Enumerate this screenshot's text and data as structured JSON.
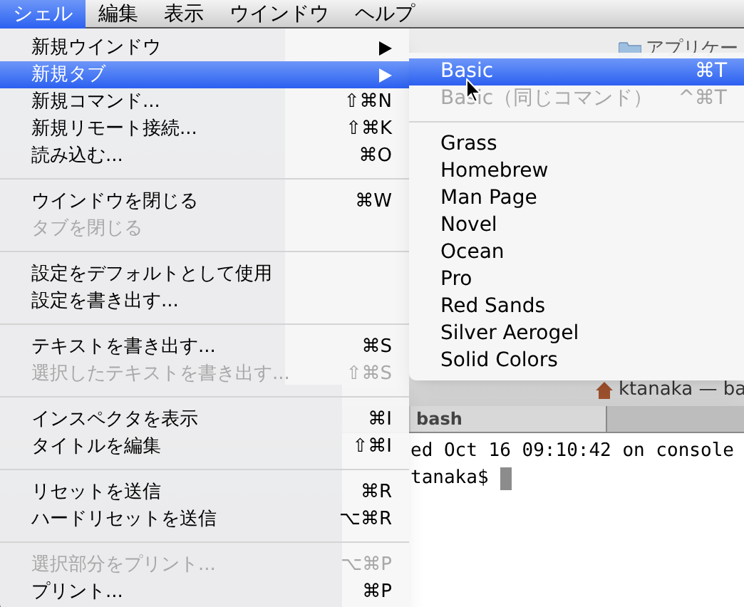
{
  "menu_bar": [
    {
      "label": "シェル",
      "selected": true
    },
    {
      "label": "編集",
      "selected": false
    },
    {
      "label": "表示",
      "selected": false
    },
    {
      "label": "ウインドウ",
      "selected": false
    },
    {
      "label": "ヘルプ",
      "selected": false
    }
  ],
  "shell_menu": [
    {
      "kind": "item",
      "label": "新規ウインドウ",
      "submenu": true,
      "selected": false,
      "disabled": false
    },
    {
      "kind": "item",
      "label": "新規タブ",
      "submenu": true,
      "selected": true,
      "disabled": false
    },
    {
      "kind": "item",
      "label": "新規コマンド...",
      "shortcut": "⇧⌘N",
      "selected": false,
      "disabled": false
    },
    {
      "kind": "item",
      "label": "新規リモート接続...",
      "shortcut": "⇧⌘K",
      "selected": false,
      "disabled": false
    },
    {
      "kind": "item",
      "label": "読み込む...",
      "shortcut": "⌘O",
      "selected": false,
      "disabled": false
    },
    {
      "kind": "separator"
    },
    {
      "kind": "item",
      "label": "ウインドウを閉じる",
      "shortcut": "⌘W",
      "selected": false,
      "disabled": false
    },
    {
      "kind": "item",
      "label": "タブを閉じる",
      "selected": false,
      "disabled": true
    },
    {
      "kind": "separator"
    },
    {
      "kind": "item",
      "label": "設定をデフォルトとして使用",
      "selected": false,
      "disabled": false
    },
    {
      "kind": "item",
      "label": "設定を書き出す...",
      "selected": false,
      "disabled": false
    },
    {
      "kind": "separator"
    },
    {
      "kind": "item",
      "label": "テキストを書き出す...",
      "shortcut": "⌘S",
      "selected": false,
      "disabled": false
    },
    {
      "kind": "item",
      "label": "選択したテキストを書き出す...",
      "shortcut": "⇧⌘S",
      "selected": false,
      "disabled": true
    },
    {
      "kind": "separator"
    },
    {
      "kind": "item",
      "label": "インスペクタを表示",
      "shortcut": "⌘I",
      "selected": false,
      "disabled": false
    },
    {
      "kind": "item",
      "label": "タイトルを編集",
      "shortcut": "⇧⌘I",
      "selected": false,
      "disabled": false
    },
    {
      "kind": "separator"
    },
    {
      "kind": "item",
      "label": "リセットを送信",
      "shortcut": "⌘R",
      "selected": false,
      "disabled": false
    },
    {
      "kind": "item",
      "label": "ハードリセットを送信",
      "shortcut": "⌥⌘R",
      "selected": false,
      "disabled": false
    },
    {
      "kind": "separator"
    },
    {
      "kind": "item",
      "label": "選択部分をプリント...",
      "shortcut": "⌥⌘P",
      "selected": false,
      "disabled": true
    },
    {
      "kind": "item",
      "label": "プリント...",
      "shortcut": "⌘P",
      "selected": false,
      "disabled": false
    }
  ],
  "new_tab_submenu": [
    {
      "kind": "item",
      "label": "Basic",
      "shortcut": "⌘T",
      "selected": true,
      "disabled": false
    },
    {
      "kind": "item",
      "label": "Basic（同じコマンド）",
      "shortcut": "^⌘T",
      "selected": false,
      "disabled": true
    },
    {
      "kind": "separator"
    },
    {
      "kind": "item",
      "label": "Grass",
      "selected": false,
      "disabled": false
    },
    {
      "kind": "item",
      "label": "Homebrew",
      "selected": false,
      "disabled": false
    },
    {
      "kind": "item",
      "label": "Man Page",
      "selected": false,
      "disabled": false
    },
    {
      "kind": "item",
      "label": "Novel",
      "selected": false,
      "disabled": false
    },
    {
      "kind": "item",
      "label": "Ocean",
      "selected": false,
      "disabled": false
    },
    {
      "kind": "item",
      "label": "Pro",
      "selected": false,
      "disabled": false
    },
    {
      "kind": "item",
      "label": "Red Sands",
      "selected": false,
      "disabled": false
    },
    {
      "kind": "item",
      "label": "Silver Aerogel",
      "selected": false,
      "disabled": false
    },
    {
      "kind": "item",
      "label": "Solid Colors",
      "selected": false,
      "disabled": false
    }
  ],
  "finder_window": {
    "location": "アプリケー"
  },
  "terminal": {
    "title": "ktanaka — ba",
    "tab": "bash",
    "lines": [
      "ed Oct 16 09:10:42 on console",
      "tanaka$"
    ]
  }
}
